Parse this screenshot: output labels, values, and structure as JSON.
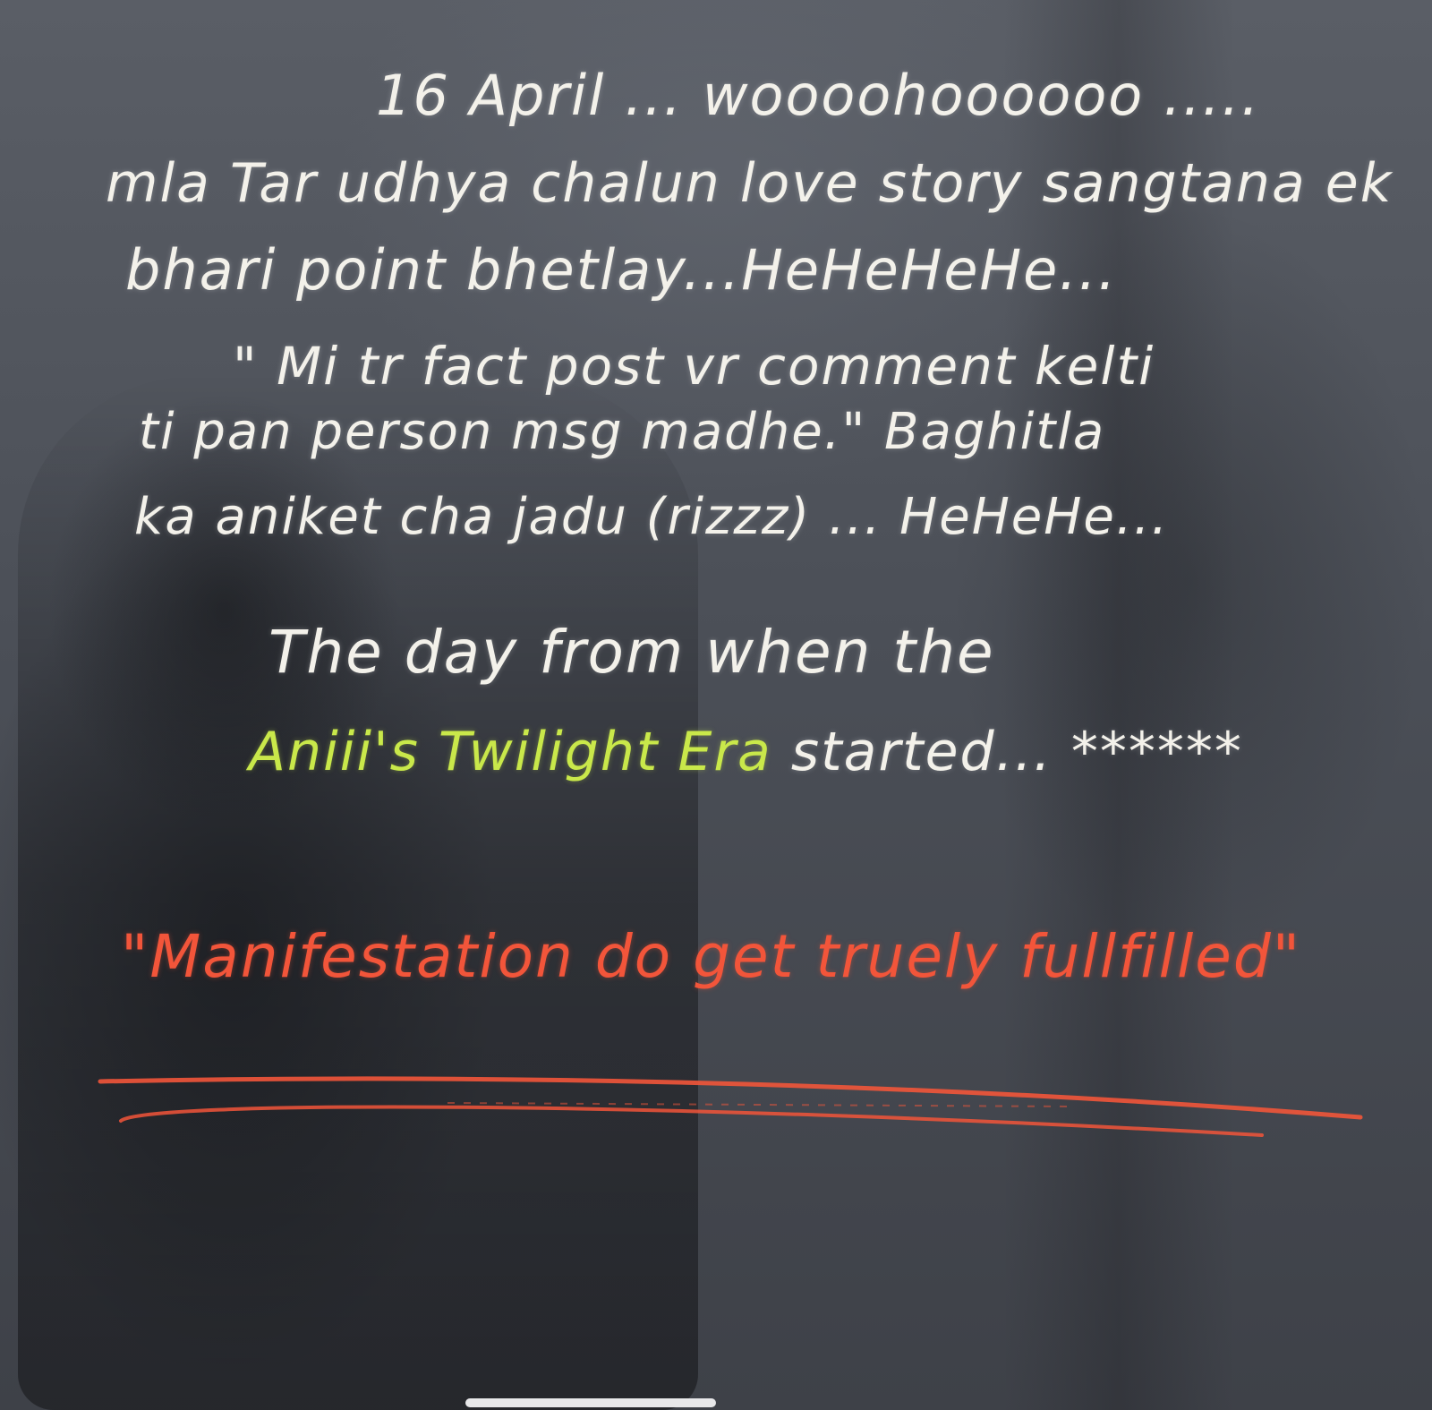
{
  "note": {
    "line1": "16 April ... woooohoooooo .....",
    "line2": "mla Tar udhya chalun love story sangtana ek",
    "line3": "bhari point bhetlay...HeHeHeHe...",
    "line4": "\" Mi tr fact post vr comment kelti",
    "line5": "ti pan person msg madhe.\" Baghitla",
    "line6": "ka aniket cha jadu (rizzz) ... HeHeHe...",
    "line7": "The day from when the",
    "line8_highlight": "Aniii's Twilight Era",
    "line8_rest": " started... ******",
    "quote": "\"Manifestation do get truely fullfilled\""
  },
  "colors": {
    "ink_white": "#f3f1ea",
    "ink_green": "#c9e84a",
    "ink_red": "#f2553a",
    "background": "#4a4e56"
  }
}
